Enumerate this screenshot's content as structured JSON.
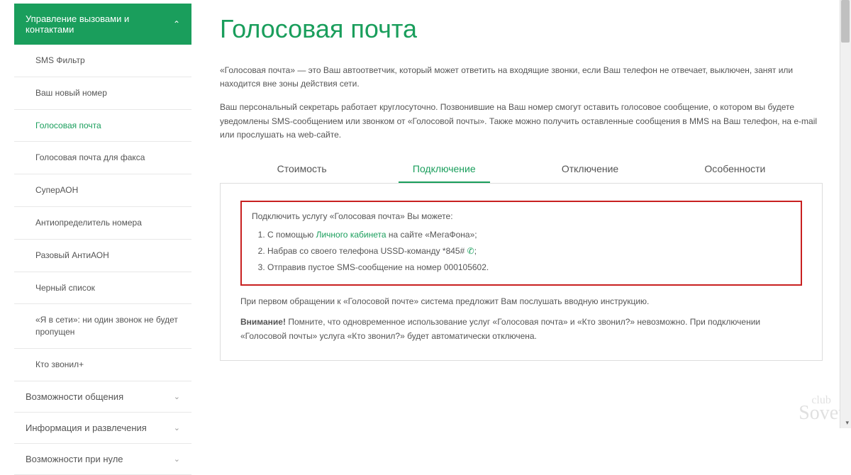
{
  "sidebar": {
    "header": "Управление вызовами и контактами",
    "items": [
      {
        "label": "SMS Фильтр",
        "active": false
      },
      {
        "label": "Ваш новый номер",
        "active": false
      },
      {
        "label": "Голосовая почта",
        "active": true
      },
      {
        "label": "Голосовая почта для факса",
        "active": false
      },
      {
        "label": "СуперАОН",
        "active": false
      },
      {
        "label": "Антиопределитель номера",
        "active": false
      },
      {
        "label": "Разовый АнтиАОН",
        "active": false
      },
      {
        "label": "Черный список",
        "active": false
      },
      {
        "label": "«Я в сети»: ни один звонок не будет пропущен",
        "active": false
      },
      {
        "label": "Кто звонил+",
        "active": false
      }
    ],
    "collapsed": [
      {
        "label": "Возможности общения"
      },
      {
        "label": "Информация и развлечения"
      },
      {
        "label": "Возможности при нуле"
      }
    ]
  },
  "main": {
    "title": "Голосовая почта",
    "desc1": "«Голосовая почта» — это Ваш автоответчик, который может ответить на входящие звонки, если Ваш телефон не отвечает, выключен, занят или находится вне зоны действия сети.",
    "desc2": "Ваш персональный секретарь работает круглосуточно. Позвонившие на Ваш номер смогут оставить голосовое сообщение, о котором вы будете уведомлены SMS-сообщением или звонком от «Голосовой почты». Также можно получить оставленные сообщения в MMS на Ваш телефон, на e-mail или прослушать на web-сайте.",
    "tabs": [
      {
        "label": "Стоимость",
        "active": false
      },
      {
        "label": "Подключение",
        "active": true
      },
      {
        "label": "Отключение",
        "active": false
      },
      {
        "label": "Особенности",
        "active": false
      }
    ],
    "box": {
      "intro": "Подключить услугу «Голосовая почта» Вы можете:",
      "item1_pre": "С помощью ",
      "item1_link": "Личного кабинета",
      "item1_post": " на сайте «МегаФона»;",
      "item2_pre": "Набрав со своего телефона USSD-команду ",
      "item2_code": "*845#",
      "item2_post": ";",
      "item3": "Отправив пустое SMS-сообщение на номер 000105602."
    },
    "after_box": "При первом обращении к «Голосовой почте» система предложит Вам послушать вводную инструкцию.",
    "warning_label": "Внимание!",
    "warning_text": " Помните, что одновременное использование услуг «Голосовая почта» и «Кто звонил?» невозможно. При подключении «Голосовой почты» услуга «Кто звонил?» будет автоматически отключена."
  },
  "watermark": {
    "top": "club",
    "bottom": "Sovet"
  }
}
